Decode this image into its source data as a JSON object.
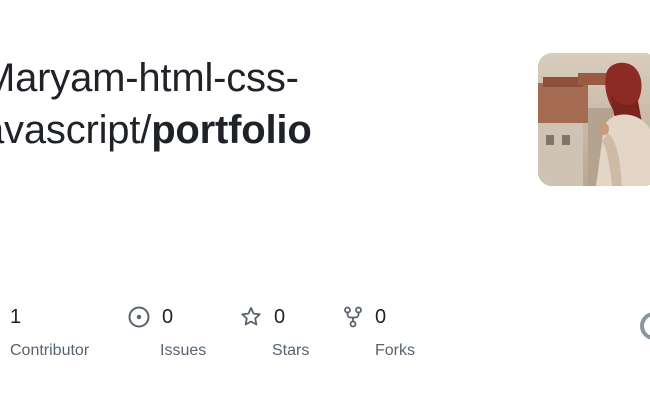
{
  "repo": {
    "owner": "Maryam-html-css-",
    "owner_cont": "avascript/",
    "name": "portfolio"
  },
  "avatar": {
    "icon": "profile-photo"
  },
  "stats": {
    "contributors": {
      "count": "1",
      "label": "Contributor"
    },
    "issues": {
      "count": "0",
      "label": "Issues",
      "icon": "issue-opened-icon"
    },
    "stars": {
      "count": "0",
      "label": "Stars",
      "icon": "star-icon"
    },
    "forks": {
      "count": "0",
      "label": "Forks",
      "icon": "repo-forked-icon"
    }
  },
  "colors": {
    "text": "#1f2328",
    "muted": "#59636e",
    "icon": "#59636e"
  }
}
